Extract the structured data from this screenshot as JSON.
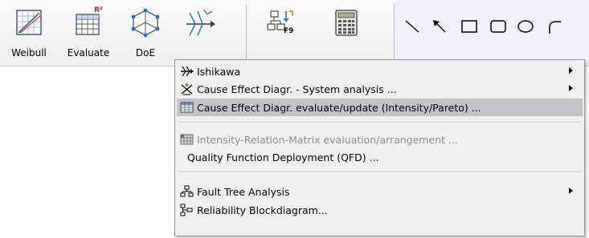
{
  "toolbar": {
    "buttons": [
      {
        "label": "Weibull",
        "icon": "weibull-plot-icon"
      },
      {
        "label": "Evaluate",
        "icon": "evaluate-table-icon",
        "badge": "R²"
      },
      {
        "label": "DoE",
        "icon": "doe-cube-icon"
      },
      {
        "label": "",
        "icon": "cause-effect-icon"
      },
      {
        "label": "",
        "icon": "function-key-icon",
        "badge": "F9"
      },
      {
        "label": "",
        "icon": "calculator-icon"
      }
    ],
    "drawing_tools": [
      "line-tool-icon",
      "arrow-tool-icon",
      "rectangle-tool-icon",
      "rounded-rectangle-tool-icon",
      "ellipse-tool-icon",
      "arc-tool-icon"
    ]
  },
  "menu": {
    "items": [
      {
        "label": "Ishikawa",
        "icon": "ishikawa-icon",
        "submenu": true,
        "disabled": false,
        "highlighted": false
      },
      {
        "label": "Cause Effect Diagr. - System analysis ...",
        "icon": "system-analysis-icon",
        "submenu": true,
        "disabled": false,
        "highlighted": false
      },
      {
        "label": "Cause Effect Diagr. evaluate/update (Intensity/Pareto) ...",
        "icon": "pareto-table-icon",
        "submenu": false,
        "disabled": false,
        "highlighted": true
      },
      {
        "label": "Intensity-Relation-Matrix evaluation/arrangement ...",
        "icon": "matrix-icon",
        "submenu": false,
        "disabled": true,
        "highlighted": false
      },
      {
        "label": "Quality Function Deployment (QFD) ...",
        "icon": "",
        "submenu": false,
        "disabled": false,
        "highlighted": false
      },
      {
        "label": "Fault Tree Analysis",
        "icon": "fault-tree-icon",
        "submenu": true,
        "disabled": false,
        "highlighted": false
      },
      {
        "label": "Reliability Blockdiagram...",
        "icon": "block-diagram-icon",
        "submenu": false,
        "disabled": false,
        "highlighted": false
      }
    ]
  },
  "colors": {
    "highlight": "#c4c4c8",
    "menu_bg": "#f0f0f0",
    "disabled_text": "#8e8e8e",
    "drawing_area": "#eef1f8"
  }
}
